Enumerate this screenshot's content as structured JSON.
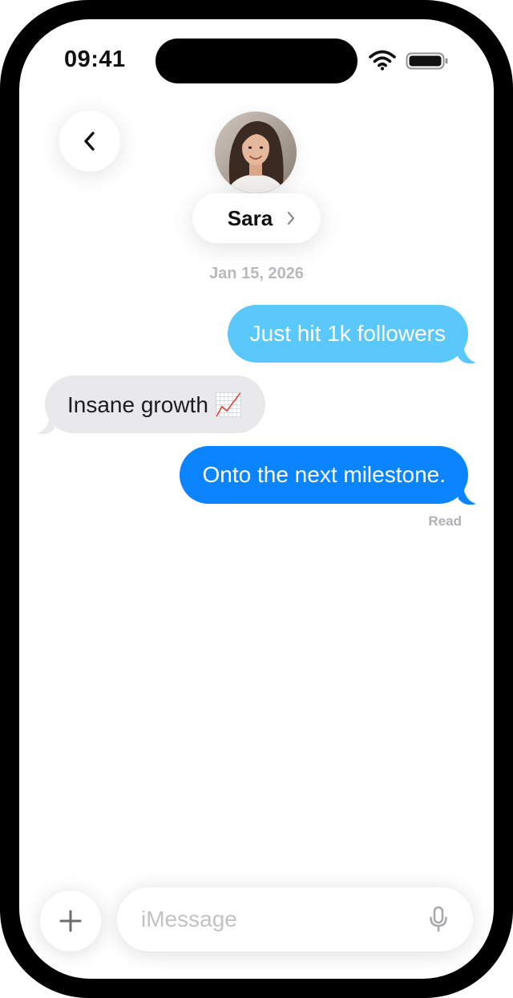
{
  "status_bar": {
    "time": "09:41"
  },
  "header": {
    "contact_name": "Sara",
    "back_icon": "chevron-left-icon",
    "name_chevron_icon": "chevron-right-icon"
  },
  "conversation": {
    "date": "Jan 15, 2026",
    "messages": [
      {
        "direction": "outgoing",
        "text": "Just hit 1k followers",
        "color": "#5ac8fa"
      },
      {
        "direction": "incoming",
        "text": "Insane growth 📈",
        "color": "#e9e9eb"
      },
      {
        "direction": "outgoing",
        "text": "Onto the next milestone.",
        "color": "#0a84ff"
      }
    ],
    "read_receipt": "Read"
  },
  "composer": {
    "placeholder": "iMessage",
    "add_icon": "plus-icon",
    "mic_icon": "microphone-icon"
  }
}
